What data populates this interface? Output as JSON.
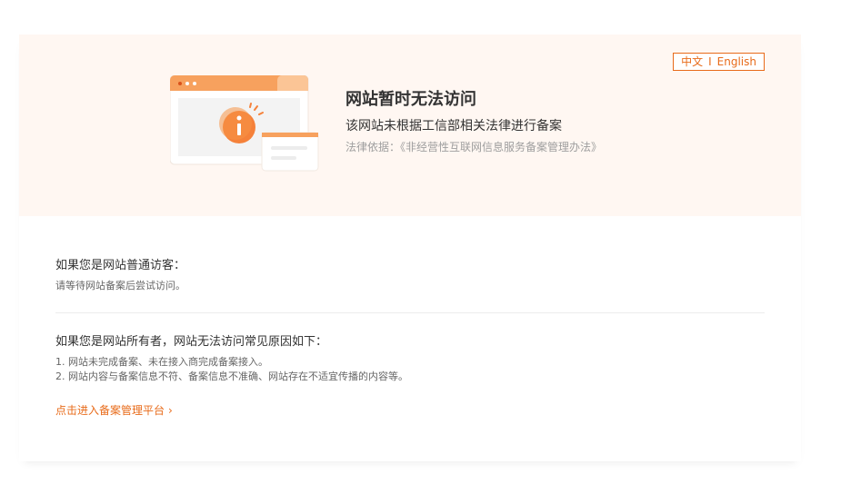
{
  "banner": {
    "lang_zh": "中文",
    "lang_sep": "I",
    "lang_en": "English",
    "title": "网站暂时无法访问",
    "subtitle": "该网站未根据工信部相关法律进行备案",
    "law": "法律依据：《非经营性互联网信息服务备案管理办法》"
  },
  "visitor": {
    "title": "如果您是网站普通访客：",
    "text": "请等待网站备案后尝试访问。"
  },
  "owner": {
    "title": "如果您是网站所有者，网站无法访问常见原因如下：",
    "reasons": [
      "1. 网站未完成备案、未在接入商完成备案接入。",
      "2. 网站内容与备案信息不符、备案信息不准确、网站存在不适宜传播的内容等。"
    ]
  },
  "link": {
    "label": "点击进入备案管理平台",
    "chevron": "›"
  },
  "colors": {
    "accent": "#e86b1a",
    "banner_bg": "#fff7f2"
  },
  "icons": {
    "illustration": "browser-window-warning-illustration",
    "info": "info-icon"
  }
}
